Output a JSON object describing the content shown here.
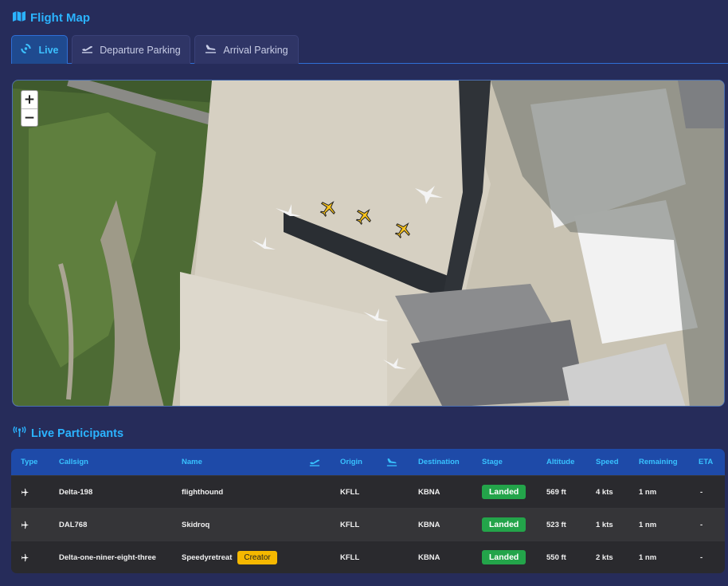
{
  "header": {
    "title": "Flight Map"
  },
  "tabs": [
    {
      "label": "Live",
      "icon": "live-spinner-icon",
      "active": true
    },
    {
      "label": "Departure Parking",
      "icon": "departure-icon",
      "active": false
    },
    {
      "label": "Arrival Parking",
      "icon": "arrival-icon",
      "active": false
    }
  ],
  "map": {
    "zoom_in": "+",
    "zoom_out": "−"
  },
  "participants": {
    "title": "Live Participants",
    "columns": {
      "type": "Type",
      "callsign": "Callsign",
      "name": "Name",
      "origin": "Origin",
      "destination": "Destination",
      "stage": "Stage",
      "altitude": "Altitude",
      "speed": "Speed",
      "remaining": "Remaining",
      "eta": "ETA"
    },
    "rows": [
      {
        "callsign": "Delta-198",
        "name": "flighthound",
        "origin": "KFLL",
        "destination": "KBNA",
        "stage": "Landed",
        "altitude": "569 ft",
        "speed": "4 kts",
        "remaining": "1 nm",
        "eta": "-"
      },
      {
        "callsign": "DAL768",
        "name": "Skidroq",
        "origin": "KFLL",
        "destination": "KBNA",
        "stage": "Landed",
        "altitude": "523 ft",
        "speed": "1 kts",
        "remaining": "1 nm",
        "eta": "-"
      },
      {
        "callsign": "Delta-one-niner-eight-three",
        "name": "Speedyretreat",
        "badge": "Creator",
        "origin": "KFLL",
        "destination": "KBNA",
        "stage": "Landed",
        "altitude": "550 ft",
        "speed": "2 kts",
        "remaining": "1 nm",
        "eta": "-"
      }
    ]
  },
  "colors": {
    "accent": "#2bb3ff",
    "header_bg": "#1e4aa8",
    "landed": "#23a44a",
    "creator": "#f5b800",
    "page_bg": "#262c5a"
  }
}
